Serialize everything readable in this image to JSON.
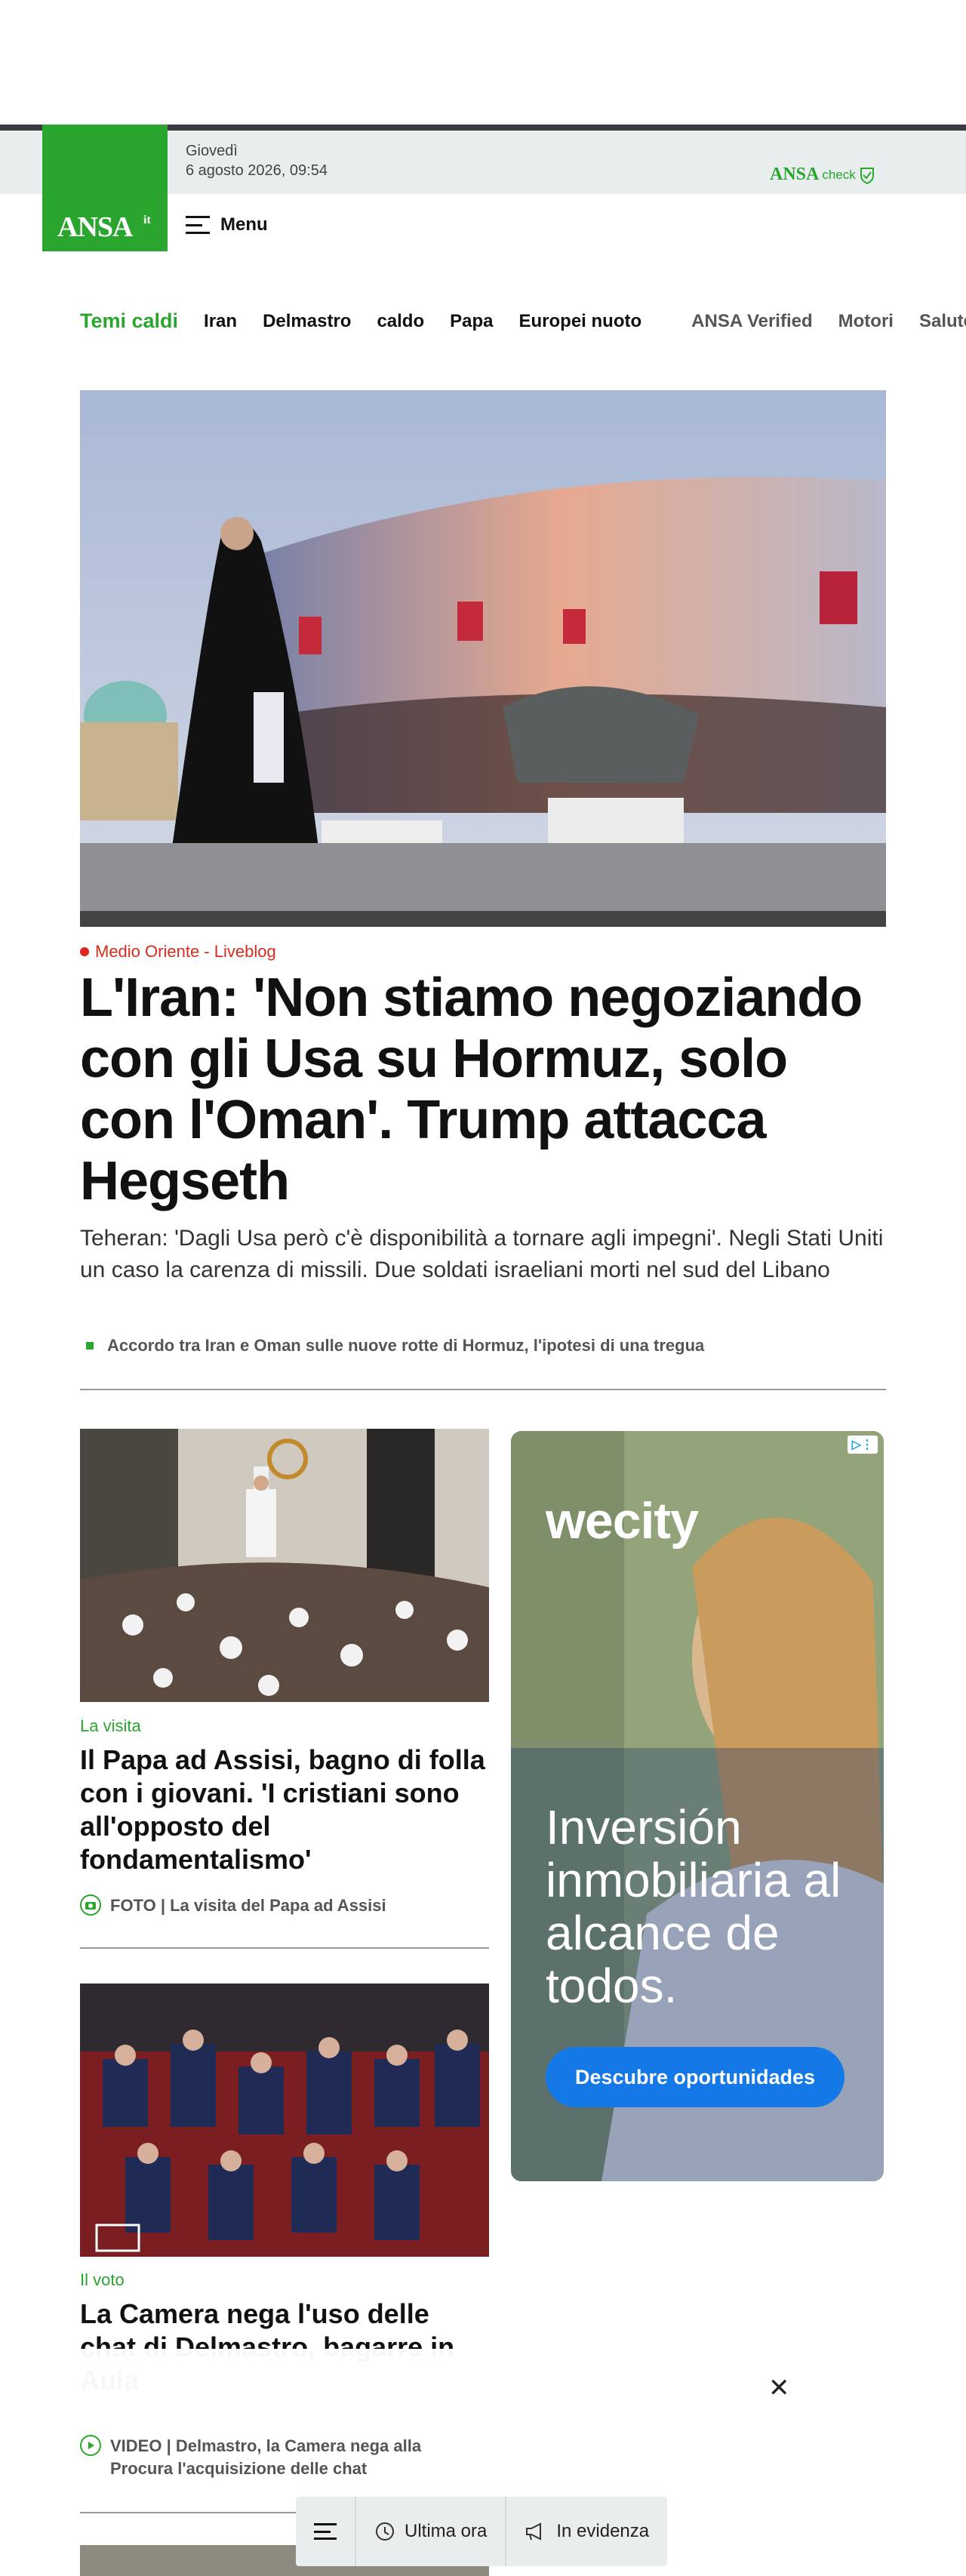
{
  "header": {
    "date_line1": "Giovedì",
    "date_line2": "6 agosto 2026, 09:54",
    "logo_text": "ANSA",
    "logo_sup": "it",
    "check_brand": "ANSA",
    "check_suffix": "check",
    "menu_label": "Menu"
  },
  "topics": {
    "hot_label": "Temi caldi",
    "items": [
      "Iran",
      "Delmastro",
      "caldo",
      "Papa",
      "Europei nuoto"
    ],
    "sections": [
      "ANSA Verified",
      "Motori",
      "Salute&"
    ]
  },
  "hero": {
    "kicker": "Medio Oriente - Liveblog",
    "title": "L'Iran: 'Non stiamo negoziando con gli Usa su Hormuz, solo con l'Oman'. Trump attacca Hegseth",
    "summary": "Teheran: 'Dagli Usa però c'è disponibilità a tornare agli impegni'. Negli Stati Uniti un caso la carenza di missili. Due soldati israeliani morti nel sud del Libano",
    "related": "Accordo tra Iran e Oman sulle nuove rotte di Hormuz, l'ipotesi di una tregua"
  },
  "cards": [
    {
      "category": "La visita",
      "title": "Il Papa ad Assisi, bagno di folla con i giovani. 'I cristiani sono all'opposto del fondamentalismo'",
      "link": "FOTO | La visita del Papa ad Assisi"
    },
    {
      "category": "Il voto",
      "title": "La Camera nega l'uso delle chat di Delmastro, bagarre in Aula",
      "link": "VIDEO | Delmastro, la Camera nega alla Procura l'acquisizione delle chat"
    }
  ],
  "ad": {
    "brand": "wecity",
    "headline": "Inversión inmobiliaria al alcance de todos.",
    "cta": "Descubre oportunidades",
    "choice": "▷⋮"
  },
  "bottom_nav": {
    "latest": "Ultima ora",
    "featured": "In evidenza"
  },
  "colors": {
    "brand_green": "#2aa52e",
    "kicker_red": "#d62b1e",
    "ad_button": "#1478e6"
  }
}
